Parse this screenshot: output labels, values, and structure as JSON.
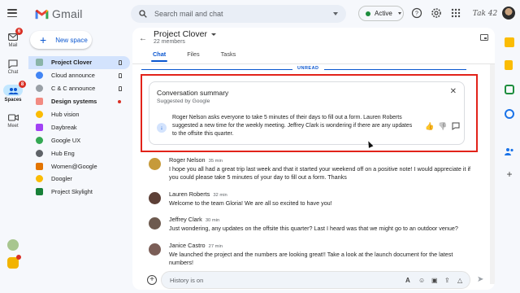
{
  "app": {
    "name": "Gmail"
  },
  "search": {
    "placeholder": "Search mail and chat"
  },
  "status": {
    "label": "Active"
  },
  "account": {
    "label": "Tak 42"
  },
  "rail": {
    "mail": {
      "label": "Mail",
      "badge": "6"
    },
    "chat": {
      "label": "Chat"
    },
    "spaces": {
      "label": "Spaces",
      "badge": "8"
    },
    "meet": {
      "label": "Meet"
    }
  },
  "new_space": {
    "label": "New space"
  },
  "spaces": [
    {
      "name": "Project Clover",
      "color": "#8ab4a8",
      "selected": true,
      "pinned": true
    },
    {
      "name": "Cloud announce",
      "color": "#4285f4",
      "pinned": true
    },
    {
      "name": "C & C announce",
      "color": "#9aa0a6",
      "pinned": true
    },
    {
      "name": "Design systems",
      "color": "#f28b82",
      "unread": true
    },
    {
      "name": "Hub vision",
      "color": "#fbbc04"
    },
    {
      "name": "Daybreak",
      "color": "#a142f4"
    },
    {
      "name": "Google UX",
      "color": "#34a853"
    },
    {
      "name": "Hub Eng",
      "color": "#5f6368"
    },
    {
      "name": "Women@Google",
      "color": "#e37400"
    },
    {
      "name": "Doogler",
      "color": "#fbbc04"
    },
    {
      "name": "Project Skylight",
      "color": "#188038"
    }
  ],
  "conversation": {
    "title": "Project Clover",
    "members": "22 members",
    "tabs": [
      "Chat",
      "Files",
      "Tasks"
    ],
    "unread_label": "UNREAD"
  },
  "summary": {
    "title": "Conversation summary",
    "subtitle": "Suggested by Google",
    "text": "Roger Nelson asks everyone to take 5 minutes of their days to fill out a form. Lauren Roberts suggested a new time for the weekly meeting. Jeffrey Clark is wondering if there are any updates to the offsite this quarter."
  },
  "messages": [
    {
      "name": "Roger Nelson",
      "time": "35 min",
      "avatar_color": "#c69a3a",
      "text": "I hope you all had a great trip last week and that it started your weekend off on a positive note! I would appreciate it if you could please take 5 minutes of your day to fill out a form. Thanks"
    },
    {
      "name": "Lauren Roberts",
      "time": "32 min",
      "avatar_color": "#5d4037",
      "text": "Welcome to the team Gloria! We are all so excited to have you!"
    },
    {
      "name": "Jeffrey Clark",
      "time": "30 min",
      "avatar_color": "#6d5a4f",
      "text": "Just wondering, any updates on the offsite this quarter? Last I heard was that we might go to an outdoor venue?"
    },
    {
      "name": "Janice Castro",
      "time": "27 min",
      "avatar_color": "#7b5e57",
      "text": "We launched the project and the numbers are looking great!! Take a look at the launch document for the latest numbers!"
    }
  ],
  "composer": {
    "placeholder": "History is on"
  }
}
